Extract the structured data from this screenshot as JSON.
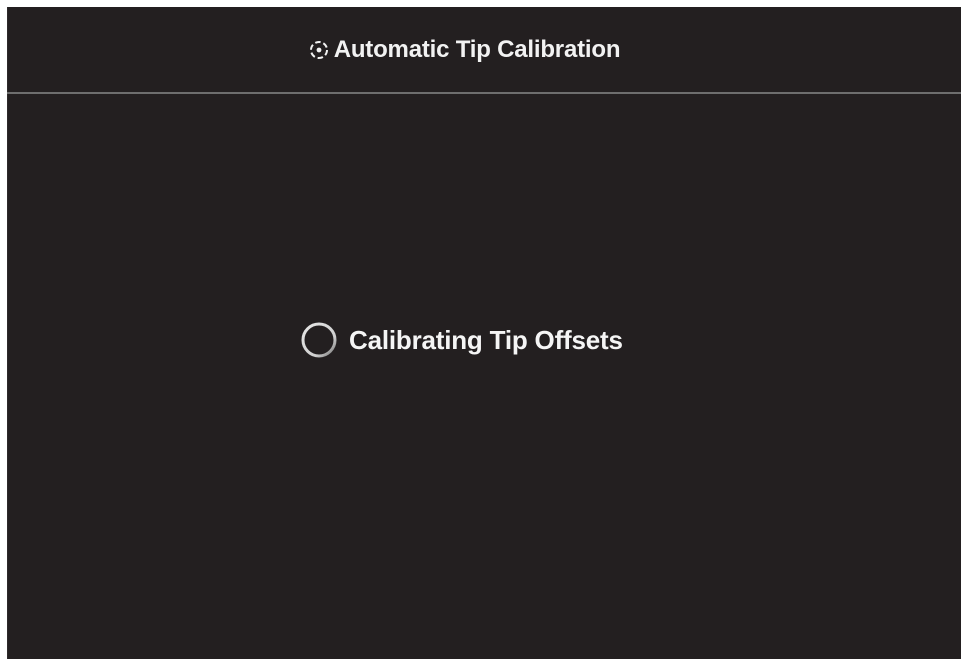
{
  "dialog": {
    "title": "Automatic Tip Calibration",
    "title_icon": "calibration-crosshair-icon"
  },
  "status": {
    "message": "Calibrating Tip Offsets",
    "indicator_icon": "loading-spinner-icon"
  },
  "colors": {
    "background": "#231f20",
    "text": "#f2f2f2",
    "divider": "#6e6e6e",
    "spinner": "#d8d8d8",
    "spinner_fade": "#777777"
  }
}
